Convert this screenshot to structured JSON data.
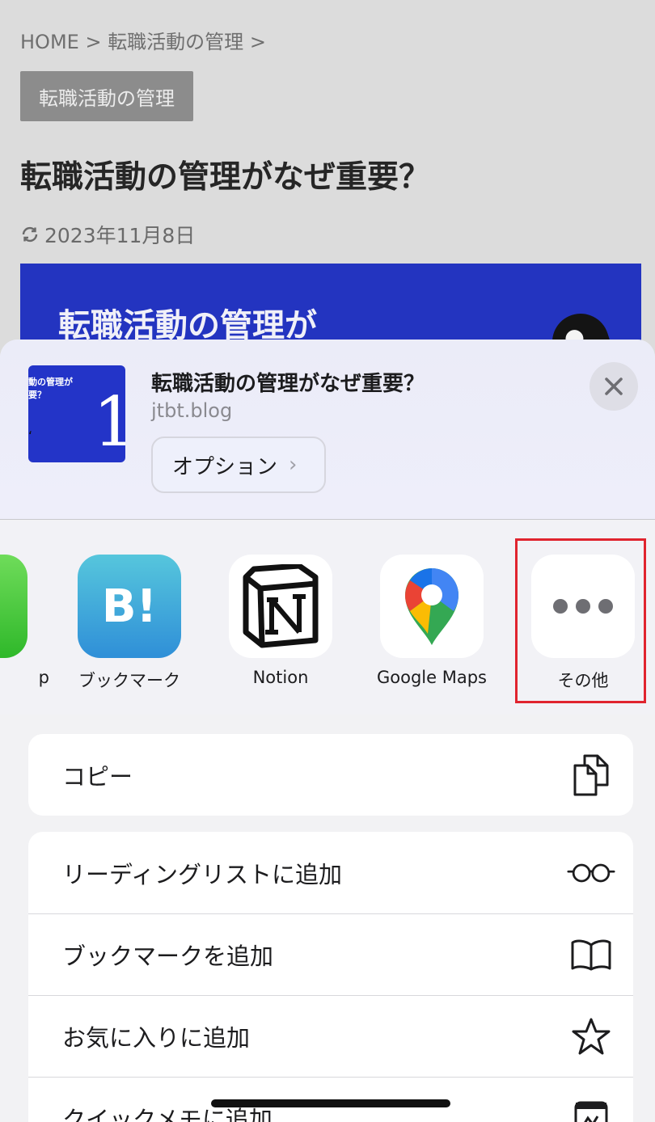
{
  "background_page": {
    "breadcrumb": [
      "HOME >",
      "転職活動の管理 >"
    ],
    "category_tag": "転職活動の管理",
    "title": "転職活動の管理がなぜ重要？",
    "date": "2023年11月8日",
    "hero_text": "転職活動の管理が"
  },
  "share_sheet": {
    "thumbnail": {
      "line1": "動の管理が",
      "line2": "要？",
      "number": "1"
    },
    "title": "転職活動の管理がなぜ重要？",
    "domain": "jtbt.blog",
    "options_label": "オプション",
    "options_chevron": "›",
    "apps": [
      {
        "label": "p"
      },
      {
        "label": "ブックマーク",
        "icon_text": "B!"
      },
      {
        "label": "Notion"
      },
      {
        "label": "Google Maps"
      },
      {
        "label": "その他"
      }
    ],
    "actions_group1": [
      {
        "label": "コピー"
      }
    ],
    "actions_group2": [
      {
        "label": "リーディングリストに追加"
      },
      {
        "label": "ブックマークを追加"
      },
      {
        "label": "お気に入りに追加"
      },
      {
        "label": "クイックメモに追加"
      }
    ]
  },
  "colors": {
    "highlight_border": "#e0242e",
    "hero_blue": "#2334c0",
    "hatena_blue": "#2f8fd8"
  }
}
